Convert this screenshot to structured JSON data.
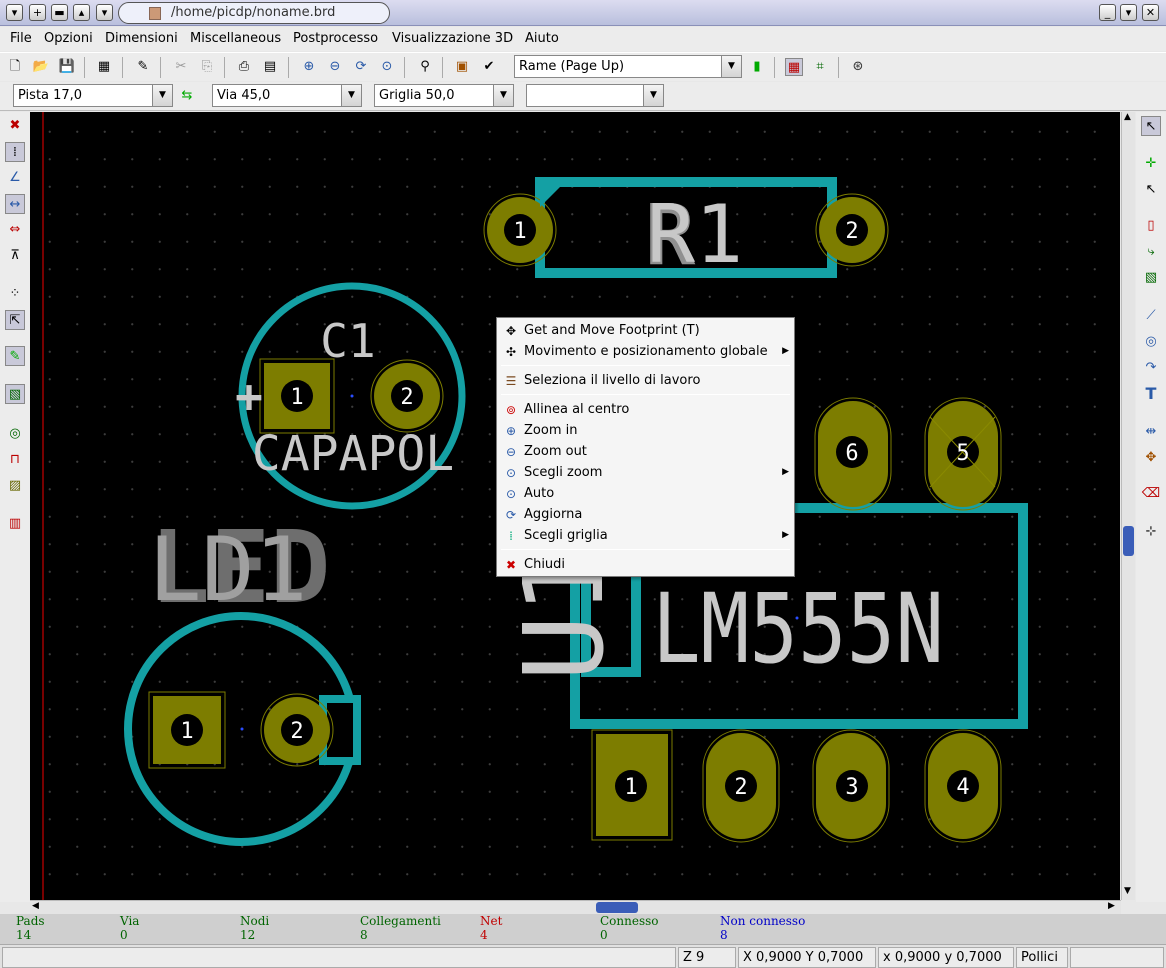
{
  "window": {
    "title": "/home/picdp/noname.brd",
    "buttons": [
      "menu-down",
      "plus",
      "minimize-bar",
      "up",
      "down"
    ],
    "right_buttons": [
      "minimize",
      "shade",
      "close"
    ]
  },
  "menubar": [
    "File",
    "Opzioni",
    "Dimensioni",
    "Miscellaneous",
    "Postprocesso",
    "Visualizzazione 3D",
    "Aiuto"
  ],
  "toolbar1": {
    "icons": [
      "new-board-icon",
      "open-icon",
      "save-icon",
      "page-settings-icon",
      "edit-module-icon",
      "cut-icon",
      "copy-icon",
      "print-icon",
      "plot-icon",
      "zoom-in-icon",
      "zoom-out-icon",
      "redraw-icon",
      "zoom-auto-icon",
      "find-icon",
      "netlist-icon",
      "drc-icon",
      "layer-pair-icon",
      "show-ratsnest-icon",
      "module-ratsnest-icon",
      "autoroute-icon"
    ],
    "layer_select": "Rame (Page Up)"
  },
  "toolbar2": {
    "track_width": "Pista 17,0",
    "via_size": "Via 45,0",
    "grid": "Griglia 50,0",
    "zoom_select": ""
  },
  "context_menu": {
    "items": [
      {
        "icon": "move-footprint-icon",
        "label": "Get and Move Footprint (T)",
        "submenu": false
      },
      {
        "icon": "global-move-icon",
        "label": "Movimento e posizionamento globale",
        "submenu": true
      },
      {
        "sep": true
      },
      {
        "icon": "layers-icon",
        "label": "Seleziona il livello di lavoro",
        "submenu": false
      },
      {
        "sep": true
      },
      {
        "icon": "zoom-center-icon",
        "label": "Allinea al centro",
        "submenu": false
      },
      {
        "icon": "zoom-in-icon",
        "label": "Zoom in",
        "submenu": false
      },
      {
        "icon": "zoom-out-icon",
        "label": "Zoom out",
        "submenu": false
      },
      {
        "icon": "zoom-select-icon",
        "label": "Scegli zoom",
        "submenu": true
      },
      {
        "icon": "zoom-auto-icon",
        "label": "Auto",
        "submenu": false
      },
      {
        "icon": "redraw-icon",
        "label": "Aggiorna",
        "submenu": false
      },
      {
        "icon": "grid-icon",
        "label": "Scegli griglia",
        "submenu": true
      },
      {
        "sep": true
      },
      {
        "icon": "close-icon",
        "label": "Chiudi",
        "submenu": false
      }
    ]
  },
  "board": {
    "components": [
      {
        "ref": "R1",
        "pads": [
          "1",
          "2"
        ]
      },
      {
        "ref": "C1",
        "value": "CAPAPOL",
        "pads": [
          "1",
          "2"
        ]
      },
      {
        "ref": "LD1",
        "pads": [
          "1",
          "2"
        ]
      },
      {
        "ref": "U1",
        "value": "LM555N",
        "pads": [
          "1",
          "2",
          "3",
          "4",
          "5",
          "6"
        ]
      }
    ],
    "labels": {
      "r1": "R1",
      "r1_value": "R",
      "c1": "C1",
      "c1_value": "CAPAPOL",
      "ld1": "LD1",
      "ld1_value": "LED",
      "u1": "U1",
      "u1_value": "LM555N",
      "plus": "+"
    },
    "colors": {
      "copper": "#7d7d00",
      "silkscreen": "#14a0a4",
      "text": "#c8c8c8",
      "background": "#000000"
    }
  },
  "stats": [
    {
      "label": "Pads",
      "value": "14",
      "color": "#006400"
    },
    {
      "label": "Via",
      "value": "0",
      "color": "#006400"
    },
    {
      "label": "Nodi",
      "value": "12",
      "color": "#006400"
    },
    {
      "label": "Collegamenti",
      "value": "8",
      "color": "#006400"
    },
    {
      "label": "Net",
      "value": "4",
      "color": "#c00000"
    },
    {
      "label": "Connesso",
      "value": "0",
      "color": "#006400"
    },
    {
      "label": "Non connesso",
      "value": "8",
      "color": "#0000c8"
    }
  ],
  "statusbar": {
    "zoom": "Z 9",
    "abs_coords": "X 0,9000  Y 0,7000",
    "rel_coords": "x 0,9000  y 0,7000",
    "units": "Pollici"
  }
}
